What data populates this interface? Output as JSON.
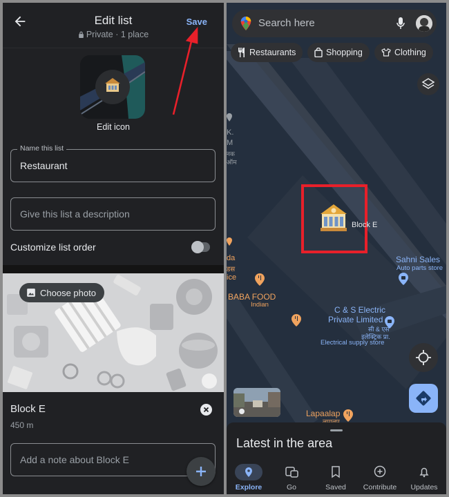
{
  "left": {
    "header": {
      "title": "Edit list",
      "subtitle": "Private · 1 place",
      "save_label": "Save"
    },
    "icon_label": "Edit icon",
    "name_field": {
      "legend": "Name this list",
      "value": "Restaurant"
    },
    "description_field": {
      "placeholder": "Give this list a description"
    },
    "customize_label": "Customize list order",
    "customize_on": false,
    "choose_photo_label": "Choose photo",
    "place": {
      "name": "Block E",
      "distance": "450 m"
    },
    "note_field": {
      "placeholder": "Add a note about Block E"
    }
  },
  "right": {
    "search": {
      "placeholder": "Search here"
    },
    "chips": [
      "Restaurants",
      "Shopping",
      "Clothing"
    ],
    "map_labels": {
      "block_e": "Block E",
      "sahni_name": "Sahni Sales",
      "sahni_type": "Auto parts store",
      "baba_name": "BABA FOOD",
      "baba_type": "Indian",
      "cs_line1": "C & S Electric",
      "cs_line2": "Private Limited",
      "cs_hindi": "सी & एस",
      "cs_hindi2": "इलेक्ट्रिक प्रा.",
      "cs_type": "Electrical supply store",
      "lapaalap": "Lapaalap",
      "lapaalap_hindi": "लपालप",
      "left_edge_1": "K.",
      "left_edge_2": "M",
      "left_edge_3": "नक",
      "left_edge_4": "ऑम",
      "left_edge_5": "da",
      "left_edge_6": "डस",
      "left_edge_7": "ice"
    },
    "latest_title": "Latest in the area",
    "nav": [
      "Explore",
      "Go",
      "Saved",
      "Contribute",
      "Updates"
    ],
    "active_nav": "Explore"
  },
  "colors": {
    "accent": "#8ab4f8",
    "annotation_red": "#e8202a",
    "place_label_blue": "#8ab4f8",
    "food_orange": "#f0a35e"
  }
}
